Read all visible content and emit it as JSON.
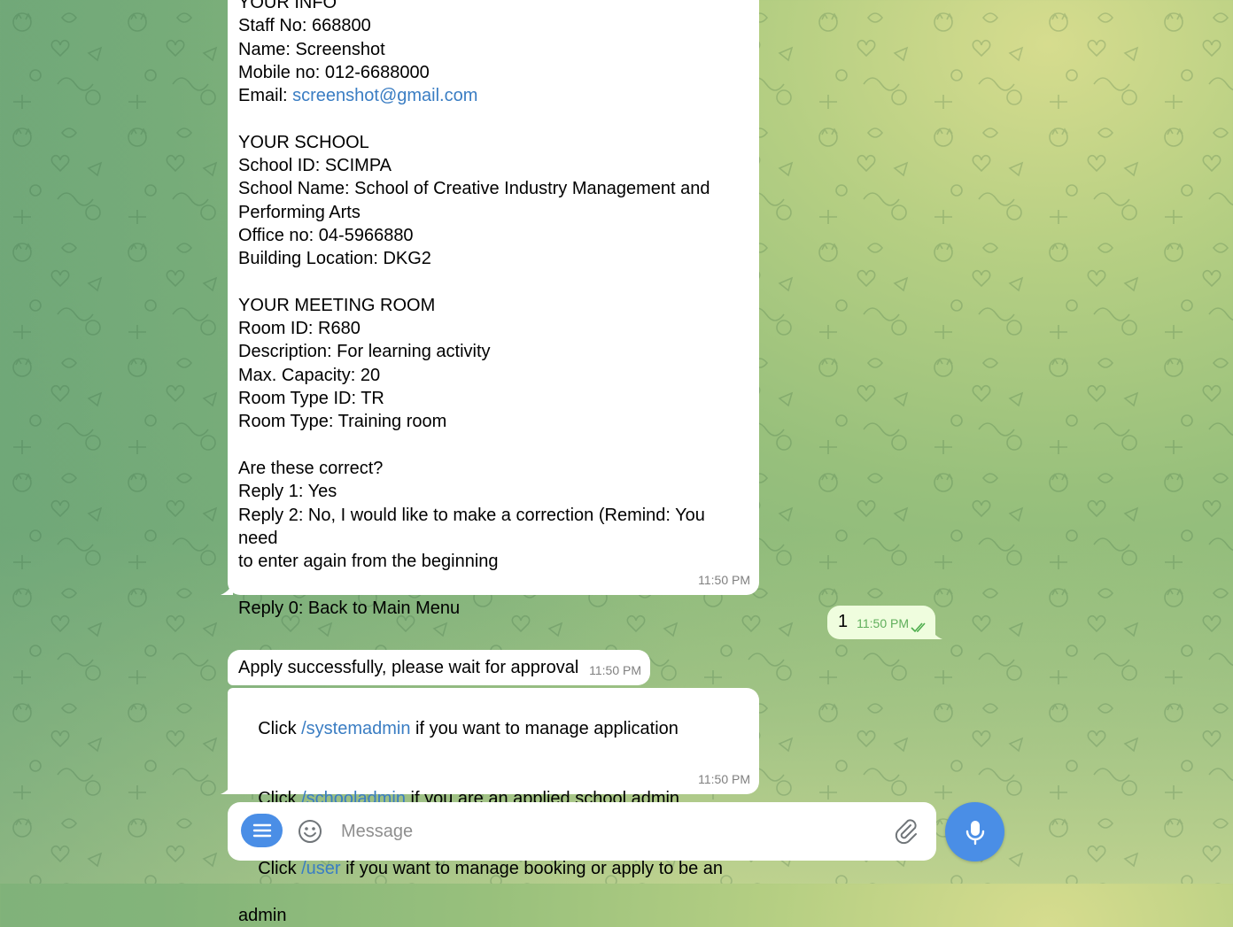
{
  "colors": {
    "bubble_out": "#effdde",
    "bubble_in": "#ffffff",
    "accent": "#4a8ee6",
    "link": "#3a7dc3",
    "check": "#4fae4e"
  },
  "messages": {
    "info": {
      "lines": [
        "YOUR INFO",
        "Staff No: 668800",
        "Name: Screenshot",
        "Mobile no: 012-6688000",
        "Email: ",
        "",
        "YOUR SCHOOL",
        "School ID: SCIMPA",
        "School Name: School of Creative Industry Management and",
        "Performing Arts",
        "Office no: 04-5966880",
        "Building Location: DKG2",
        "",
        "YOUR MEETING ROOM",
        "Room ID: R680",
        "Description: For learning activity",
        "Max. Capacity: 20",
        "Room Type ID: TR",
        "Room Type: Training room",
        "",
        "Are these correct?",
        "Reply 1: Yes",
        "Reply 2: No, I would like to make a correction (Remind: You need",
        "to enter again from the beginning",
        "",
        "Reply 0: Back to Main Menu"
      ],
      "email_link": "screenshot@gmail.com",
      "time": "11:50 PM"
    },
    "outgoing": {
      "text": "1",
      "time": "11:50 PM"
    },
    "apply": {
      "text": "Apply successfully, please wait for approval",
      "time": "11:50 PM"
    },
    "commands": {
      "rows": [
        {
          "pre": "Click ",
          "link": "/systemadmin",
          "post": " if you want to manage application"
        },
        {
          "pre": "Click ",
          "link": "/schooladmin",
          "post": " if you are an applied school admin"
        },
        {
          "pre": "Click ",
          "link": "/user",
          "post": " if you want to manage booking or apply to be an"
        }
      ],
      "last_line": "admin",
      "time": "11:50 PM"
    }
  },
  "composer": {
    "placeholder": "Message"
  },
  "icons": {
    "menu": "menu-icon",
    "emoji": "smile-icon",
    "attach": "paperclip-icon",
    "mic": "microphone-icon",
    "read": "double-check-icon"
  }
}
